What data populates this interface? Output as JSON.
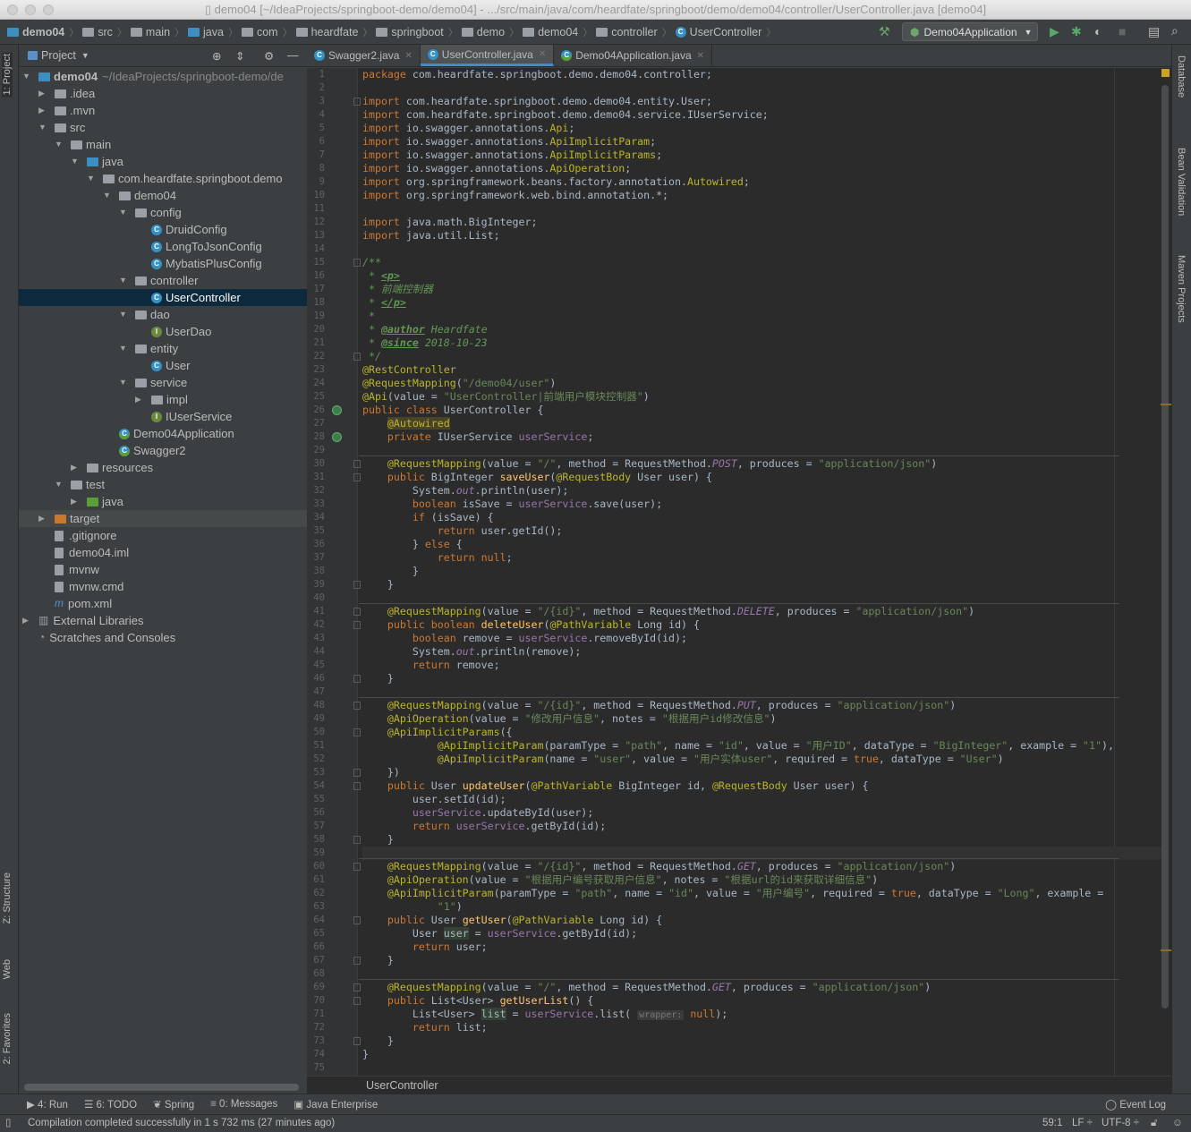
{
  "window": {
    "title": "demo04 [~/IdeaProjects/springboot-demo/demo04] - .../src/main/java/com/heardfate/springboot/demo/demo04/controller/UserController.java [demo04]"
  },
  "navbar": {
    "crumbs": [
      {
        "label": "demo04",
        "icon": "module-folder"
      },
      {
        "label": "src",
        "icon": "folder"
      },
      {
        "label": "main",
        "icon": "folder"
      },
      {
        "label": "java",
        "icon": "source-folder"
      },
      {
        "label": "com",
        "icon": "package"
      },
      {
        "label": "heardfate",
        "icon": "package"
      },
      {
        "label": "springboot",
        "icon": "package"
      },
      {
        "label": "demo",
        "icon": "package"
      },
      {
        "label": "demo04",
        "icon": "package"
      },
      {
        "label": "controller",
        "icon": "package"
      },
      {
        "label": "UserController",
        "icon": "class"
      }
    ],
    "run_config": "Demo04Application"
  },
  "left_strip": {
    "project": "1: Project",
    "structure": "Z: Structure",
    "web": "Web",
    "favorites": "2: Favorites"
  },
  "right_strip": {
    "database": "Database",
    "bean_validation": "Bean Validation",
    "maven": "Maven Projects"
  },
  "project_panel": {
    "title": "Project",
    "tree": [
      {
        "label": "demo04",
        "muted": "~/IdeaProjects/springboot-demo/de",
        "depth": 0,
        "arrow": "open",
        "icon": "module"
      },
      {
        "label": ".idea",
        "depth": 1,
        "arrow": "closed",
        "icon": "folder"
      },
      {
        "label": ".mvn",
        "depth": 1,
        "arrow": "closed",
        "icon": "folder"
      },
      {
        "label": "src",
        "depth": 1,
        "arrow": "open",
        "icon": "folder"
      },
      {
        "label": "main",
        "depth": 2,
        "arrow": "open",
        "icon": "folder"
      },
      {
        "label": "java",
        "depth": 3,
        "arrow": "open",
        "icon": "source"
      },
      {
        "label": "com.heardfate.springboot.demo",
        "depth": 4,
        "arrow": "open",
        "icon": "package"
      },
      {
        "label": "demo04",
        "depth": 5,
        "arrow": "open",
        "icon": "package"
      },
      {
        "label": "config",
        "depth": 6,
        "arrow": "open",
        "icon": "package"
      },
      {
        "label": "DruidConfig",
        "depth": 7,
        "icon": "class"
      },
      {
        "label": "LongToJsonConfig",
        "depth": 7,
        "icon": "class"
      },
      {
        "label": "MybatisPlusConfig",
        "depth": 7,
        "icon": "class"
      },
      {
        "label": "controller",
        "depth": 6,
        "arrow": "open",
        "icon": "package"
      },
      {
        "label": "UserController",
        "depth": 7,
        "icon": "class",
        "selected": true
      },
      {
        "label": "dao",
        "depth": 6,
        "arrow": "open",
        "icon": "package"
      },
      {
        "label": "UserDao",
        "depth": 7,
        "icon": "interface"
      },
      {
        "label": "entity",
        "depth": 6,
        "arrow": "open",
        "icon": "package"
      },
      {
        "label": "User",
        "depth": 7,
        "icon": "class"
      },
      {
        "label": "service",
        "depth": 6,
        "arrow": "open",
        "icon": "package"
      },
      {
        "label": "impl",
        "depth": 7,
        "arrow": "closed",
        "icon": "package"
      },
      {
        "label": "IUserService",
        "depth": 7,
        "icon": "interface"
      },
      {
        "label": "Demo04Application",
        "depth": 5,
        "icon": "app"
      },
      {
        "label": "Swagger2",
        "depth": 5,
        "icon": "app"
      },
      {
        "label": "resources",
        "depth": 3,
        "arrow": "closed",
        "icon": "resources"
      },
      {
        "label": "test",
        "depth": 2,
        "arrow": "open",
        "icon": "folder"
      },
      {
        "label": "java",
        "depth": 3,
        "arrow": "closed",
        "icon": "test-source"
      },
      {
        "label": "target",
        "depth": 1,
        "arrow": "closed",
        "icon": "excluded",
        "excluded": true
      },
      {
        "label": ".gitignore",
        "depth": 1,
        "icon": "file"
      },
      {
        "label": "demo04.iml",
        "depth": 1,
        "icon": "file"
      },
      {
        "label": "mvnw",
        "depth": 1,
        "icon": "file"
      },
      {
        "label": "mvnw.cmd",
        "depth": 1,
        "icon": "file"
      },
      {
        "label": "pom.xml",
        "depth": 1,
        "icon": "maven"
      },
      {
        "label": "External Libraries",
        "depth": 0,
        "arrow": "closed",
        "icon": "libraries"
      },
      {
        "label": "Scratches and Consoles",
        "depth": 0,
        "icon": "scratches"
      }
    ]
  },
  "tabs": [
    {
      "label": "Swagger2.java",
      "active": false
    },
    {
      "label": "UserController.java",
      "active": true
    },
    {
      "label": "Demo04Application.java",
      "active": false
    }
  ],
  "editor": {
    "current_line": 59,
    "lines": [
      "package com.heardfate.springboot.demo.demo04.controller;",
      "",
      "import com.heardfate.springboot.demo.demo04.entity.User;",
      "import com.heardfate.springboot.demo.demo04.service.IUserService;",
      "import io.swagger.annotations.Api;",
      "import io.swagger.annotations.ApiImplicitParam;",
      "import io.swagger.annotations.ApiImplicitParams;",
      "import io.swagger.annotations.ApiOperation;",
      "import org.springframework.beans.factory.annotation.Autowired;",
      "import org.springframework.web.bind.annotation.*;",
      "",
      "import java.math.BigInteger;",
      "import java.util.List;",
      "",
      "/**",
      " * <p>",
      " * 前端控制器",
      " * </p>",
      " *",
      " * @author Heardfate",
      " * @since 2018-10-23",
      " */",
      "@RestController",
      "@RequestMapping(\"/demo04/user\")",
      "@Api(value = \"UserController|前端用户模块控制器\")",
      "public class UserController {",
      "    @Autowired",
      "    private IUserService userService;",
      "",
      "    @RequestMapping(value = \"/\", method = RequestMethod.POST, produces = \"application/json\")",
      "    public BigInteger saveUser(@RequestBody User user) {",
      "        System.out.println(user);",
      "        boolean isSave = userService.save(user);",
      "        if (isSave) {",
      "            return user.getId();",
      "        } else {",
      "            return null;",
      "        }",
      "    }",
      "",
      "    @RequestMapping(value = \"/{id}\", method = RequestMethod.DELETE, produces = \"application/json\")",
      "    public boolean deleteUser(@PathVariable Long id) {",
      "        boolean remove = userService.removeById(id);",
      "        System.out.println(remove);",
      "        return remove;",
      "    }",
      "",
      "    @RequestMapping(value = \"/{id}\", method = RequestMethod.PUT, produces = \"application/json\")",
      "    @ApiOperation(value = \"修改用户信息\", notes = \"根据用户id修改信息\")",
      "    @ApiImplicitParams({",
      "            @ApiImplicitParam(paramType = \"path\", name = \"id\", value = \"用户ID\", dataType = \"BigInteger\", example = \"1\"),",
      "            @ApiImplicitParam(name = \"user\", value = \"用户实体user\", required = true, dataType = \"User\")",
      "    })",
      "    public User updateUser(@PathVariable BigInteger id, @RequestBody User user) {",
      "        user.setId(id);",
      "        userService.updateById(user);",
      "        return userService.getById(id);",
      "    }",
      "",
      "    @RequestMapping(value = \"/{id}\", method = RequestMethod.GET, produces = \"application/json\")",
      "    @ApiOperation(value = \"根据用户编号获取用户信息\", notes = \"根据url的id来获取详细信息\")",
      "    @ApiImplicitParam(paramType = \"path\", name = \"id\", value = \"用户编号\", required = true, dataType = \"Long\", example =",
      "            \"1\")",
      "    public User getUser(@PathVariable Long id) {",
      "        User user = userService.getById(id);",
      "        return user;",
      "    }",
      "",
      "    @RequestMapping(value = \"/\", method = RequestMethod.GET, produces = \"application/json\")",
      "    public List<User> getUserList() {",
      "        List<User> list = userService.list( wrapper: null);",
      "        return list;",
      "    }",
      "}",
      ""
    ]
  },
  "editor_breadcrumb": "UserController",
  "tool_windows": [
    "4: Run",
    "6: TODO",
    "Spring",
    "0: Messages",
    "Java Enterprise"
  ],
  "event_log": "Event Log",
  "status": {
    "message": "Compilation completed successfully in 1 s 732 ms (27 minutes ago)",
    "position": "59:1",
    "line_sep": "LF ÷",
    "encoding": "UTF-8 ÷"
  },
  "colors": {
    "keyword": "#cc7832",
    "annotation": "#bbb529",
    "string": "#6a8759",
    "field": "#9876aa",
    "method": "#ffc66d",
    "doc": "#629755",
    "selection": "#0d293e",
    "accent": "#4a88c7"
  }
}
